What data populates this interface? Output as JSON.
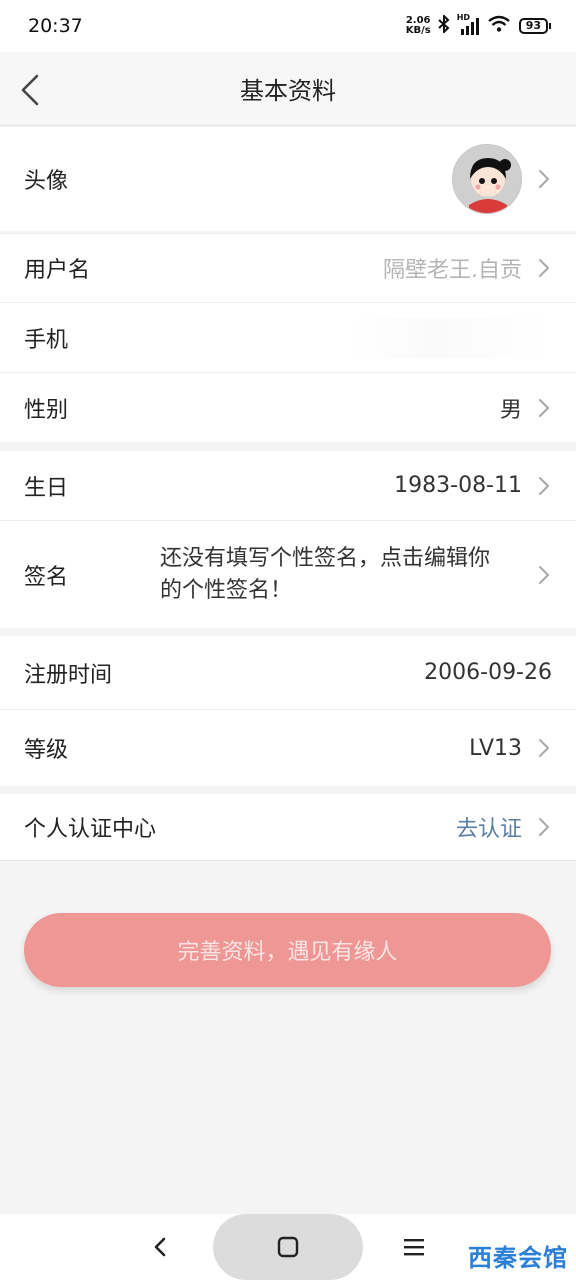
{
  "status_bar": {
    "time": "20:37",
    "net_speed_value": "2.06",
    "net_speed_unit": "KB/s",
    "hd_label": "HD",
    "battery": "93"
  },
  "header": {
    "title": "基本资料",
    "back_icon": "chevron-left-icon"
  },
  "profile": {
    "avatar": {
      "label": "头像"
    },
    "username": {
      "label": "用户名",
      "value": "隔壁老王.自贡"
    },
    "phone": {
      "label": "手机",
      "value": ""
    },
    "gender": {
      "label": "性别",
      "value": "男"
    },
    "birthday": {
      "label": "生日",
      "value": "1983-08-11"
    },
    "signature": {
      "label": "签名",
      "value": "还没有填写个性签名，点击编辑你的个性签名！"
    },
    "register_time": {
      "label": "注册时间",
      "value": "2006-09-26"
    },
    "level": {
      "label": "等级",
      "value": "LV13"
    },
    "verification": {
      "label": "个人认证中心",
      "value": "去认证"
    }
  },
  "cta": {
    "label": "完善资料，遇见有缘人"
  },
  "watermark": "西秦会馆",
  "colors": {
    "cta_background": "#ef9795",
    "link": "#5b7fa6",
    "muted_text": "#b5b5b5"
  }
}
